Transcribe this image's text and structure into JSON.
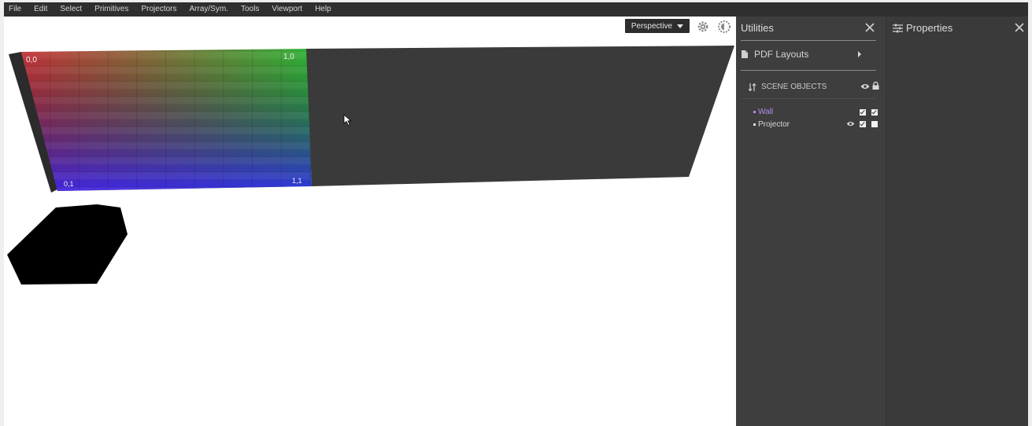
{
  "menu": [
    "File",
    "Edit",
    "Select",
    "Primitives",
    "Projectors",
    "Array/Sym.",
    "Tools",
    "Viewport",
    "Help"
  ],
  "viewport": {
    "view_mode": "Perspective",
    "corner_labels": {
      "top_left": "0,0",
      "top_right": "1,0",
      "bottom_left": "0,1",
      "bottom_right": "1,1"
    }
  },
  "utilities": {
    "title": "Utilities",
    "pdf_layouts": "PDF Layouts",
    "scene_objects_header": "SCENE OBJECTS",
    "objects": [
      {
        "name": "Wall",
        "color": "#b48ce6",
        "visible": true,
        "locked": true
      },
      {
        "name": "Projector",
        "color": "#d8d8d8",
        "visible": true,
        "locked": false
      }
    ]
  },
  "properties": {
    "title": "Properties"
  },
  "colors": {
    "menubar": "#2f2f2f",
    "panel_bg": "#3e3e3e",
    "wall_surface": "#3a3a3a",
    "projector_shape": "#000000"
  }
}
